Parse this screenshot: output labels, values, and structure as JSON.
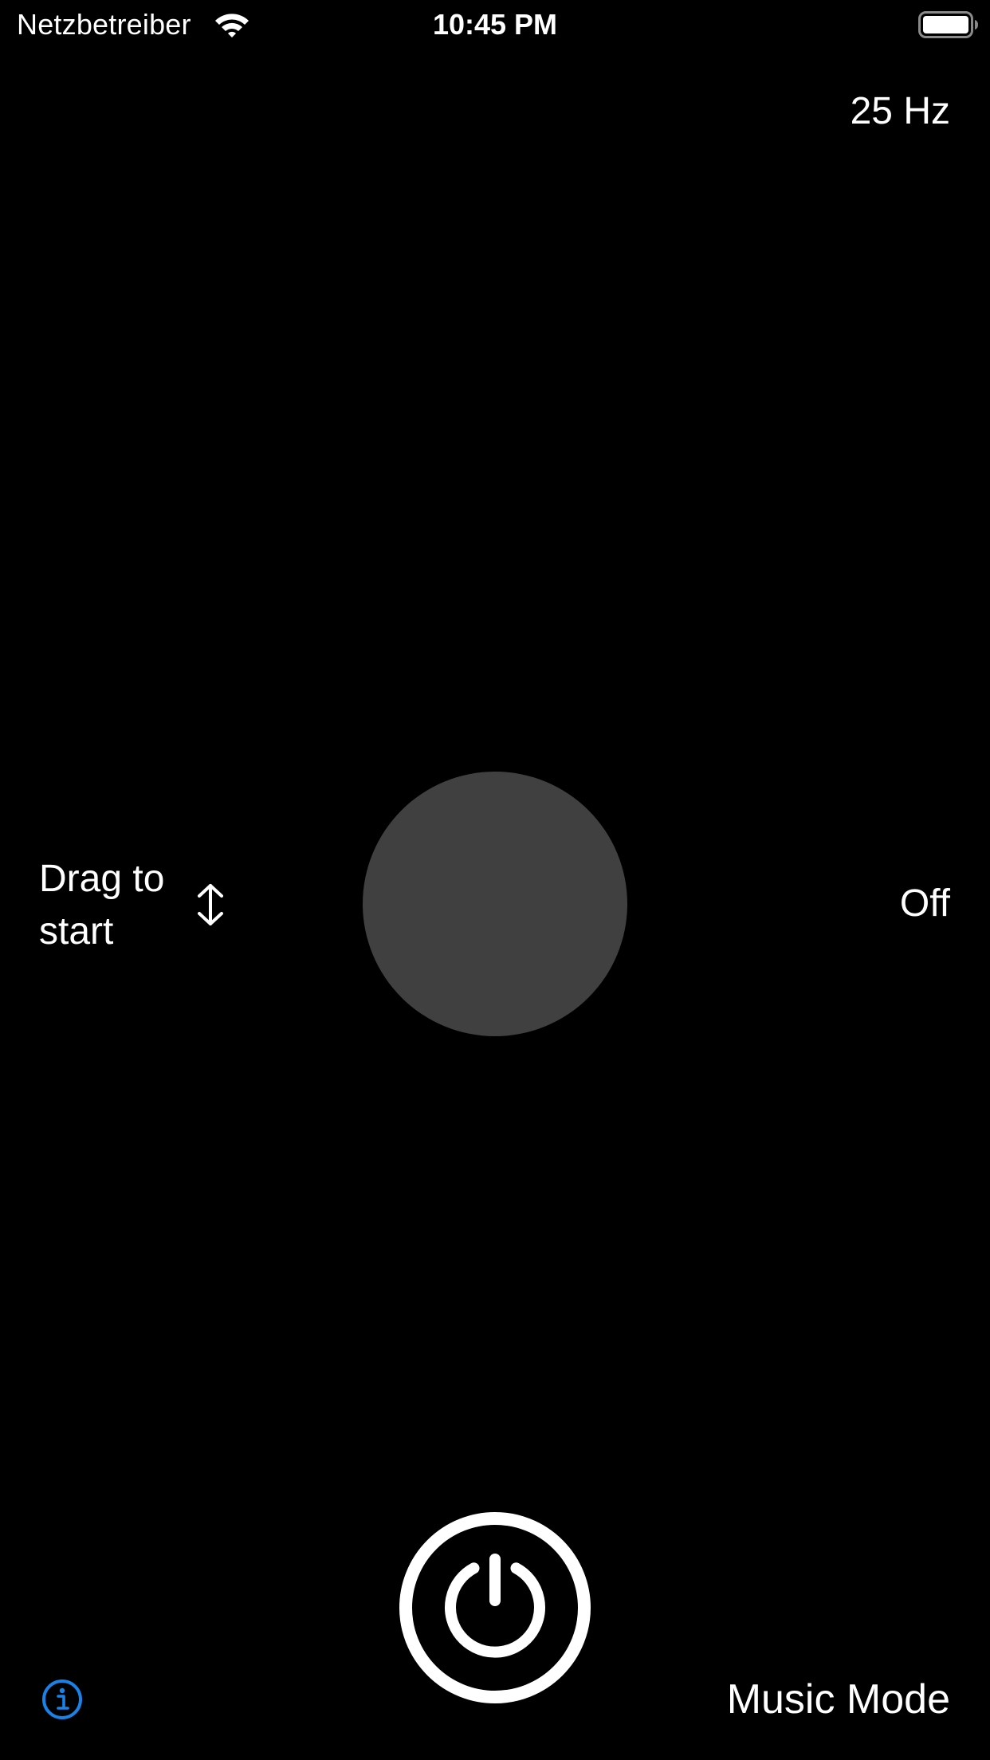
{
  "status_bar": {
    "carrier": "Netzbetreiber",
    "time": "10:45 PM",
    "wifi_icon": "wifi-icon",
    "battery_icon": "battery-full-icon",
    "battery_level": 1.0
  },
  "frequency": {
    "label": "25 Hz"
  },
  "drag_hint": {
    "text": "Drag to start",
    "icon": "vertical-arrows-icon"
  },
  "knob": {
    "color": "#404040"
  },
  "state": {
    "label": "Off"
  },
  "power_button": {
    "icon": "power-icon",
    "color": "#ffffff"
  },
  "info_button": {
    "icon": "info-icon",
    "color": "#1a82e6"
  },
  "music_mode": {
    "label": "Music Mode"
  },
  "colors": {
    "background": "#000000",
    "text": "#ffffff",
    "accent": "#1a82e6"
  }
}
